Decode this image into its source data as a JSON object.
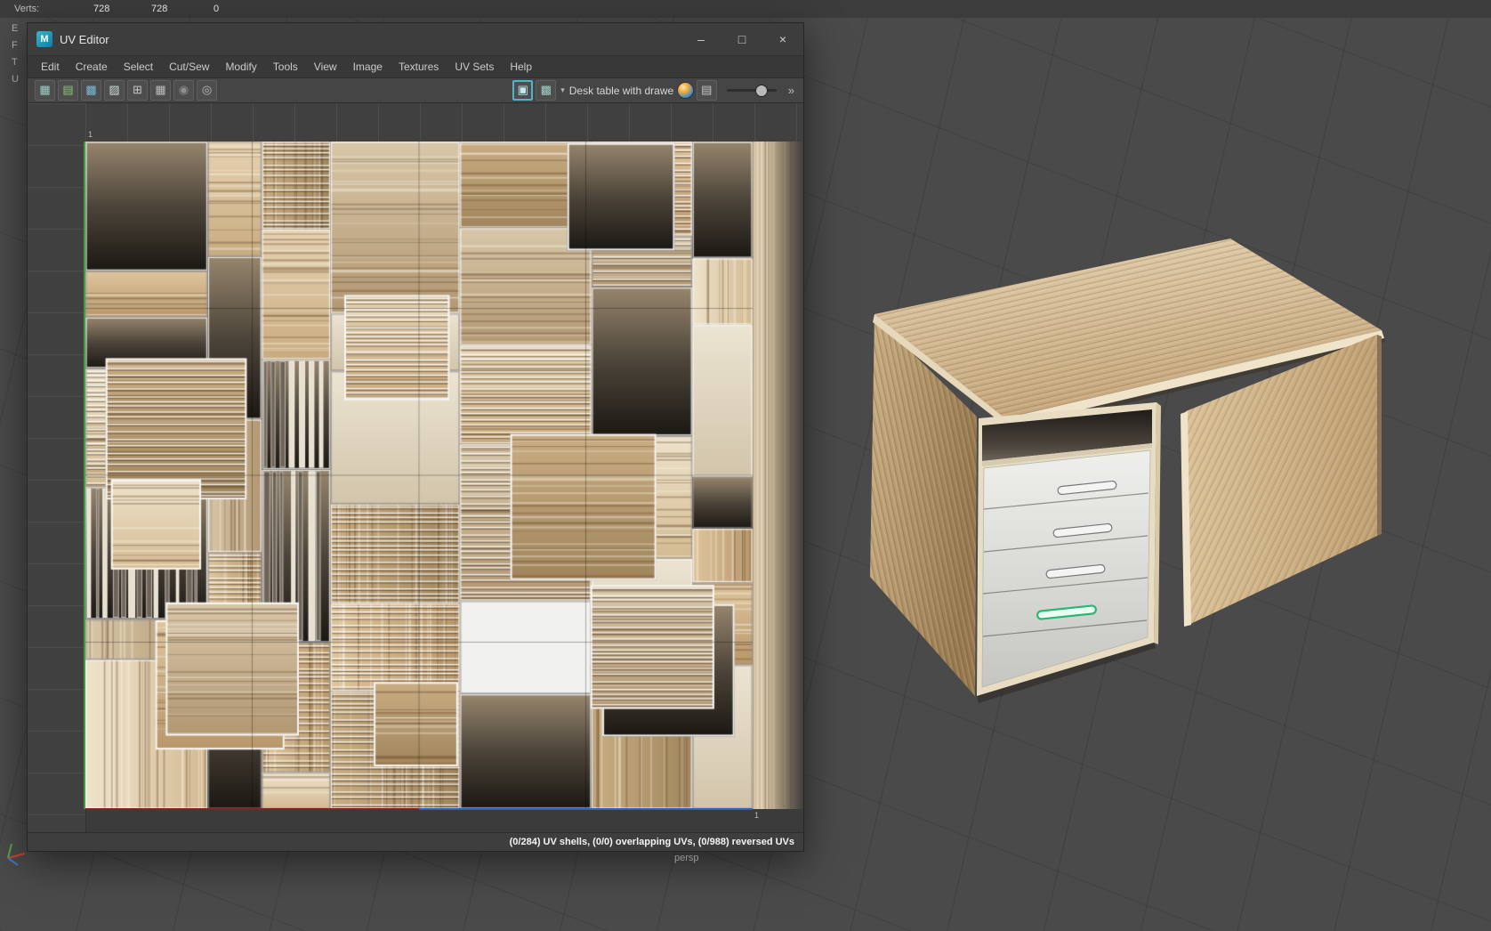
{
  "hud": {
    "verts_label": "Verts:",
    "v1": "728",
    "v2": "728",
    "v3": "0"
  },
  "panel_letters": [
    "E",
    "F",
    "T",
    "U"
  ],
  "window": {
    "title": "UV Editor",
    "minimize": "–",
    "maximize": "□",
    "close": "×"
  },
  "menu": {
    "items": [
      "Edit",
      "Create",
      "Select",
      "Cut/Sew",
      "Modify",
      "Tools",
      "View",
      "Image",
      "Textures",
      "UV Sets",
      "Help"
    ]
  },
  "toolbar": {
    "icons_left": [
      "▦",
      "▤",
      "▩",
      "▨",
      "⊞",
      "▦",
      "◉",
      "◎"
    ],
    "textured_icon": "▣",
    "checker_icon": "▩",
    "dropdown": "▾",
    "texture_name": "Desk table with drawers",
    "expand": "»"
  },
  "uv_canvas": {
    "label_top": "1",
    "label_corner": "1"
  },
  "status": {
    "text": "(0/284) UV shells, (0/0) overlapping UVs, (0/988) reversed UVs"
  },
  "viewport": {
    "camera": "persp"
  },
  "colors": {
    "accent_teal": "#4fb6c9",
    "selected_green": "#2bb673",
    "wood": "#d2b58d",
    "axis_red": "#8a1f1f",
    "axis_blue": "#2e62c8",
    "axis_green": "#3f9c3f"
  }
}
